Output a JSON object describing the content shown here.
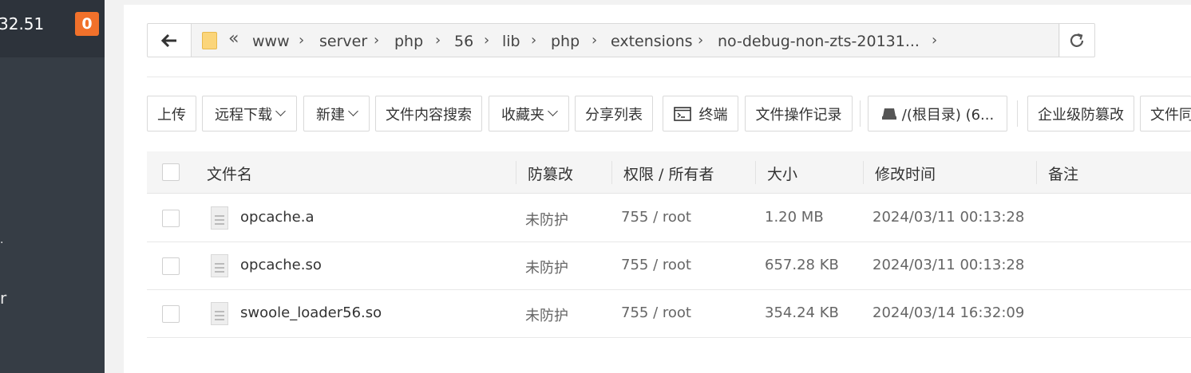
{
  "sidebar": {
    "ip_fragment": "32.51",
    "badge_count": "0",
    "menu_fragments": [
      "r"
    ]
  },
  "address_bar": {
    "breadcrumbs": [
      "www",
      "server",
      "php",
      "56",
      "lib",
      "php",
      "extensions",
      "no-debug-non-zts-20131..."
    ]
  },
  "toolbar": {
    "upload": "上传",
    "remote_download": "远程下载",
    "new": "新建",
    "content_search": "文件内容搜索",
    "favorites": "收藏夹",
    "share_list": "分享列表",
    "terminal": "终端",
    "operation_log": "文件操作记录",
    "disk": "/(根目录) (6...",
    "tamper_proof": "企业级防篡改",
    "file_sync": "文件同"
  },
  "table": {
    "headers": {
      "name": "文件名",
      "tamper": "防篡改",
      "perm": "权限 / 所有者",
      "size": "大小",
      "mtime": "修改时间",
      "note": "备注"
    },
    "rows": [
      {
        "name": "opcache.a",
        "tamper": "未防护",
        "perm": "755 / root",
        "size": "1.20 MB",
        "mtime": "2024/03/11 00:13:28"
      },
      {
        "name": "opcache.so",
        "tamper": "未防护",
        "perm": "755 / root",
        "size": "657.28 KB",
        "mtime": "2024/03/11 00:13:28"
      },
      {
        "name": "swoole_loader56.so",
        "tamper": "未防护",
        "perm": "755 / root",
        "size": "354.24 KB",
        "mtime": "2024/03/14 16:32:09"
      }
    ]
  },
  "colors": {
    "sidebar_bg": "#363d45",
    "badge": "#f1712b",
    "folder": "#fbd57a"
  }
}
